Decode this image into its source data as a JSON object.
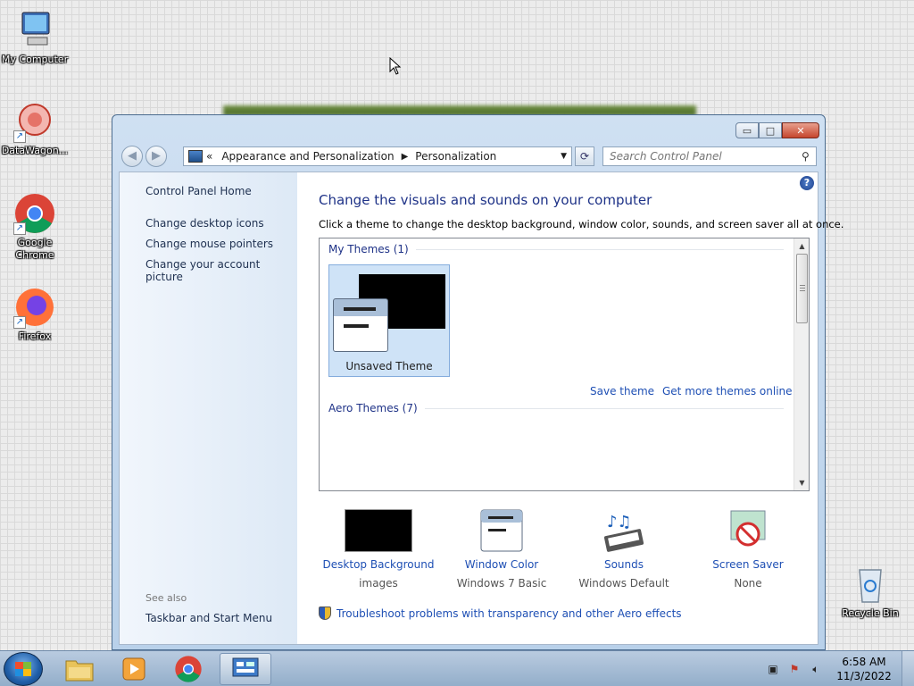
{
  "desktop": {
    "icons": [
      {
        "label": "My Computer"
      },
      {
        "label": "DataWagon..."
      },
      {
        "label": "Google Chrome"
      },
      {
        "label": "Firefox"
      },
      {
        "label": "Recycle Bin"
      }
    ]
  },
  "window": {
    "controls": {
      "minimize": "▭",
      "maximize": "□",
      "close": "✕"
    },
    "nav": {
      "back": "◀",
      "forward": "▶",
      "breadcrumb_prefix": "«",
      "crumb1": "Appearance and Personalization",
      "crumb_sep": "▶",
      "crumb2": "Personalization",
      "dropdown": "▼",
      "refresh": "⟳",
      "search_placeholder": "Search Control Panel",
      "search_icon": "⚲"
    },
    "left_pane": {
      "home": "Control Panel Home",
      "links": [
        "Change desktop icons",
        "Change mouse pointers",
        "Change your account picture"
      ],
      "see_also": "See also",
      "see_also_links": [
        "Taskbar and Start Menu"
      ]
    },
    "main": {
      "help": "?",
      "title": "Change the visuals and sounds on your computer",
      "description": "Click a theme to change the desktop background, window color, sounds, and screen saver all at once.",
      "my_themes_header": "My Themes (1)",
      "selected_theme": "Unsaved Theme",
      "save_theme": "Save theme",
      "get_more": "Get more themes online",
      "aero_header": "Aero Themes (7)",
      "bottom_items": [
        {
          "title": "Desktop Background",
          "sub": "images"
        },
        {
          "title": "Window Color",
          "sub": "Windows 7 Basic"
        },
        {
          "title": "Sounds",
          "sub": "Windows Default"
        },
        {
          "title": "Screen Saver",
          "sub": "None"
        }
      ],
      "troubleshoot": "Troubleshoot problems with transparency and other Aero effects"
    }
  },
  "taskbar": {
    "time": "6:58 AM",
    "date": "11/3/2022"
  },
  "colors": {
    "link": "#1e4fb4",
    "heading": "#1e3287",
    "taskbar": "#a9bfd8"
  }
}
